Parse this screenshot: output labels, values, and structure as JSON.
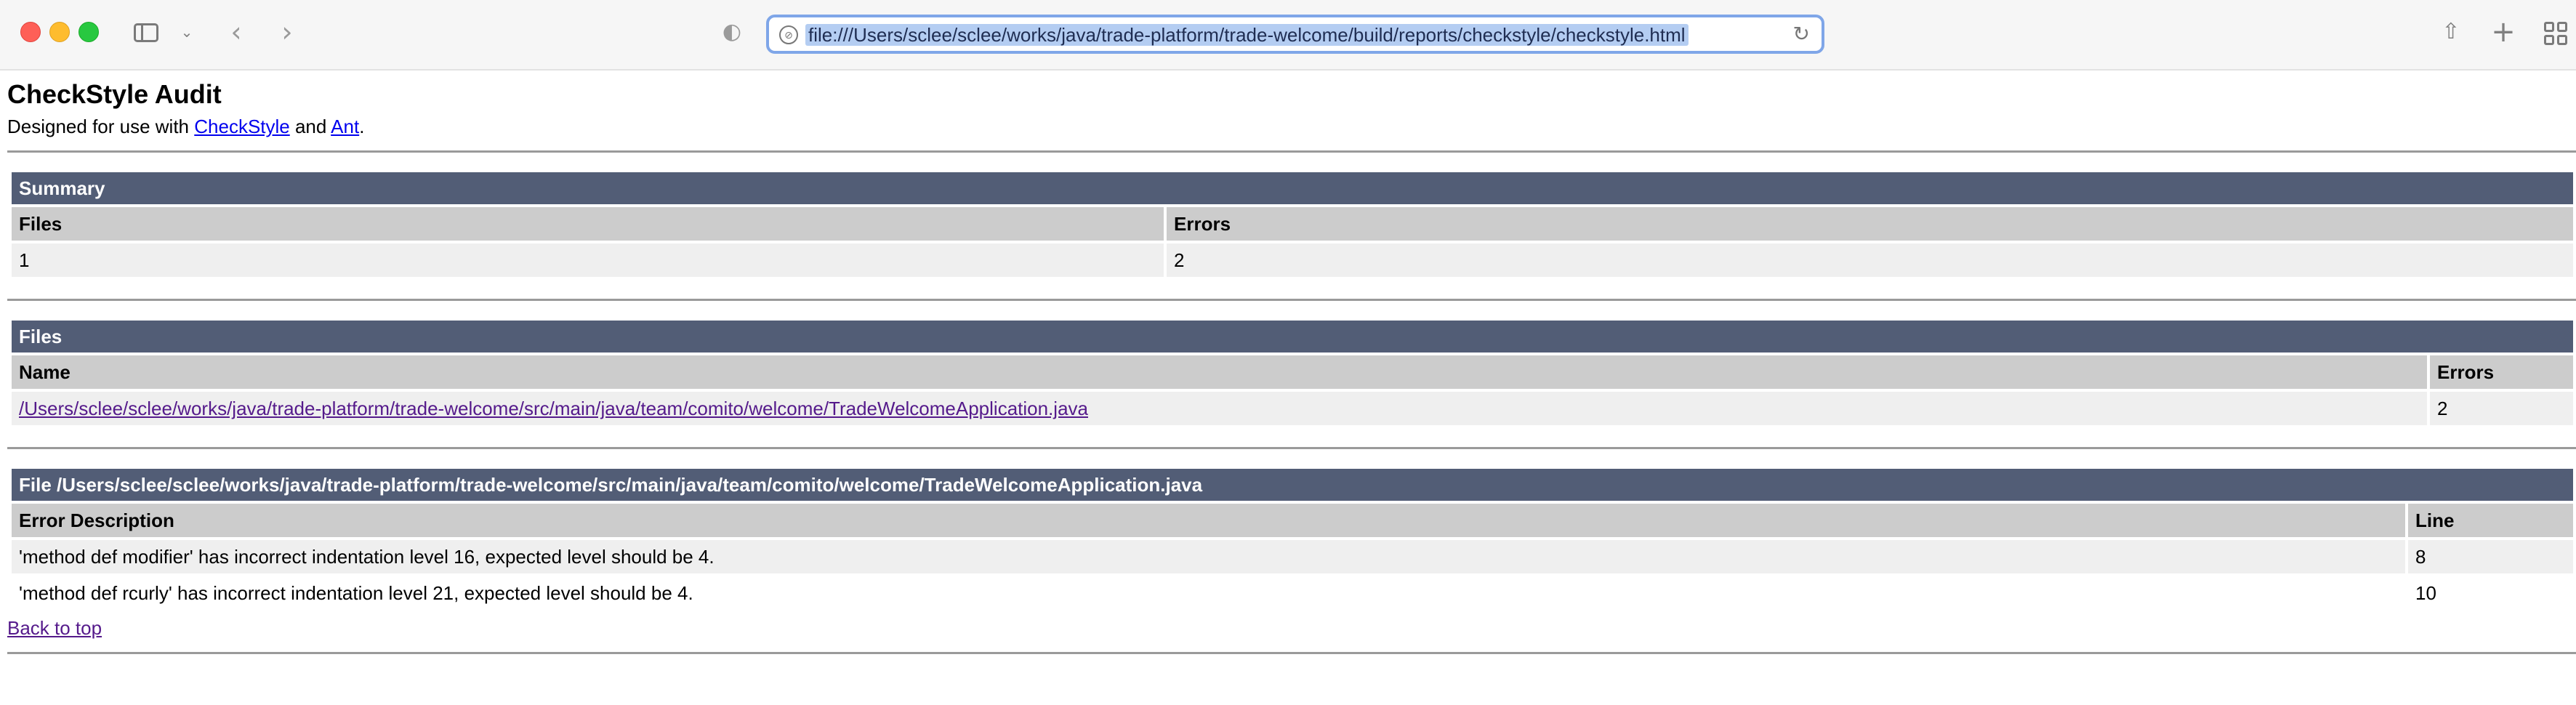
{
  "browser": {
    "url": "file:///Users/sclee/sclee/works/java/trade-platform/trade-welcome/build/reports/checkstyle/checkstyle.html"
  },
  "page": {
    "title": "CheckStyle Audit",
    "tagline_prefix": "Designed for use with ",
    "checkstyle_link": "CheckStyle",
    "tagline_middle": " and ",
    "ant_link": "Ant",
    "tagline_suffix": "."
  },
  "summary": {
    "heading": "Summary",
    "columns": [
      "Files",
      "Errors"
    ],
    "row": [
      "1",
      "2"
    ]
  },
  "files": {
    "heading": "Files",
    "columns": [
      "Name",
      "Errors"
    ],
    "rows": [
      {
        "name": "/Users/sclee/sclee/works/java/trade-platform/trade-welcome/src/main/java/team/comito/welcome/TradeWelcomeApplication.java",
        "errors": "2"
      }
    ]
  },
  "file_detail": {
    "heading": "File /Users/sclee/sclee/works/java/trade-platform/trade-welcome/src/main/java/team/comito/welcome/TradeWelcomeApplication.java",
    "columns": [
      "Error Description",
      "Line"
    ],
    "rows": [
      {
        "description": "'method def modifier' has incorrect indentation level 16, expected level should be 4.",
        "line": "8"
      },
      {
        "description": "'method def rcurly' has incorrect indentation level 21, expected level should be 4.",
        "line": "10"
      }
    ],
    "back_to_top": "Back to top"
  }
}
